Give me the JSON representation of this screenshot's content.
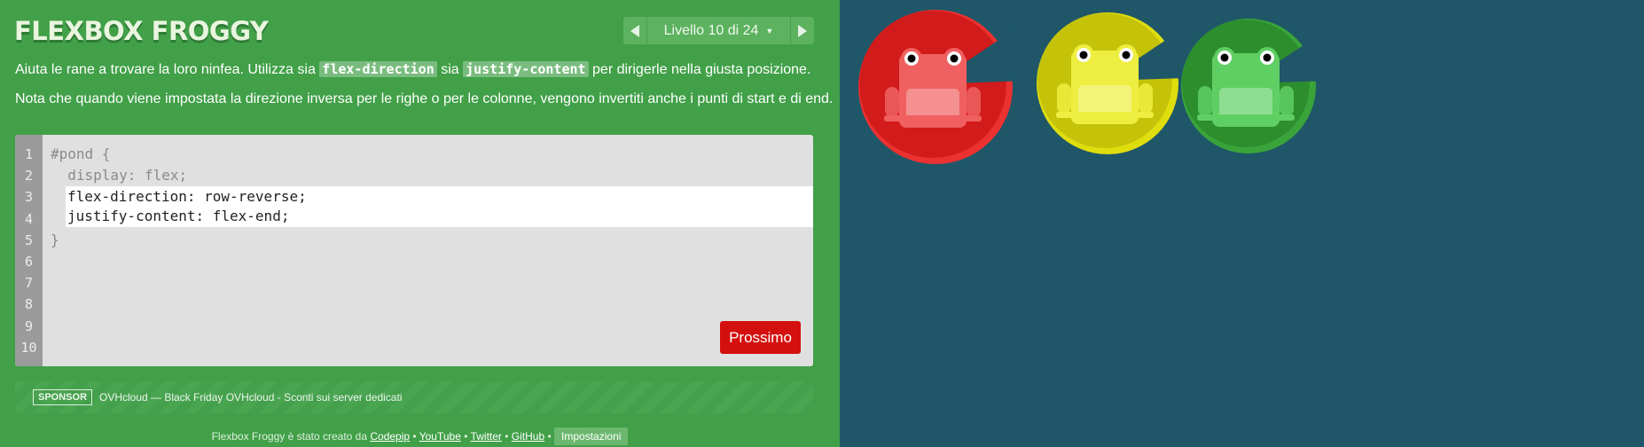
{
  "app": {
    "title": "FLEXBOX FROGGY"
  },
  "level_nav": {
    "label": "Livello 10 di 24"
  },
  "instructions": {
    "line1": {
      "before": "Aiuta le rane a trovare la loro ninfea. Utilizza sia",
      "kw1": "flex-direction",
      "mid": "sia",
      "kw2": "justify-content",
      "after": "per dirigerle nella giusta posizione."
    },
    "line2": "Nota che quando viene impostata la direzione inversa per le righe o per le colonne, vengono invertiti anche i punti di start e di end."
  },
  "editor": {
    "line_numbers": [
      "1",
      "2",
      "3",
      "4",
      "5",
      "6",
      "7",
      "8",
      "9",
      "10"
    ],
    "lines": [
      "#pond {",
      "  display: flex;",
      "",
      "",
      "}"
    ],
    "input_lines": [
      "flex-direction: row-reverse;",
      "justify-content: flex-end;"
    ],
    "next_button": "Prossimo"
  },
  "sponsor": {
    "tag": "SPONSOR",
    "text": "OVHcloud — Black Friday OVHcloud - Sconti sui server dedicati"
  },
  "footer": {
    "prefix": "Flexbox Froggy è stato creato da",
    "links": [
      "Codepip",
      "YouTube",
      "Twitter",
      "GitHub"
    ],
    "separator": "•",
    "settings": "Impostazioni"
  },
  "frogs": [
    {
      "color": "red",
      "frog_color": "#f06060",
      "pad_color": "#d21b1b",
      "pad_rim": "#ec3131"
    },
    {
      "color": "yellow",
      "frog_color": "#eeee40",
      "pad_color": "#c5c20a",
      "pad_rim": "#e0dd0e"
    },
    {
      "color": "green",
      "frog_color": "#5fcf64",
      "pad_color": "#2d8e2e",
      "pad_rim": "#3aa43b"
    }
  ],
  "colors": {
    "sidebar": "#41a048",
    "pond": "#1f5768",
    "next_button": "#d4100f"
  }
}
